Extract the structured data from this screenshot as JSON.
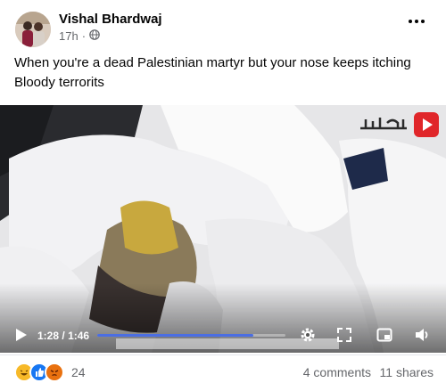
{
  "post": {
    "author": "Vishal Bhardwaj",
    "time": "17h",
    "audience_icon": "globe-icon",
    "caption_lines": [
      "When you're a dead Palestinian martyr but your nose keeps itching",
      "Bloody terrorits"
    ]
  },
  "video": {
    "current_time": "1:28",
    "duration": "1:46",
    "time_separator": "/",
    "progress_fraction": 0.83,
    "watermark_icon": "play-logo-icon",
    "colors": {
      "progress": "#4b6ee3",
      "logo": "#e0262a"
    }
  },
  "footer": {
    "reaction_icons": [
      "haha-icon",
      "like-icon",
      "angry-icon"
    ],
    "reaction_count": "24",
    "comments": "4 comments",
    "shares": "11 shares"
  }
}
